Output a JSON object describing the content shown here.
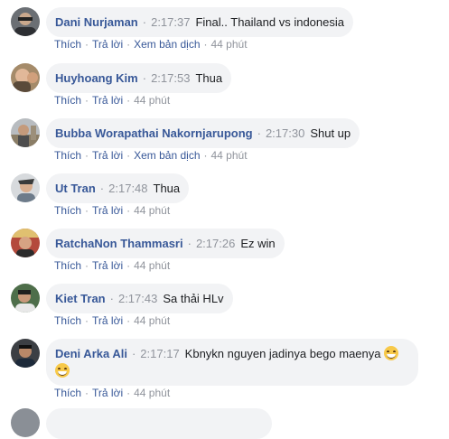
{
  "actions": {
    "like": "Thích",
    "reply": "Trả lời",
    "translate": "Xem bản dịch",
    "separator": "·"
  },
  "comments": [
    {
      "name": "Dani Nurjaman",
      "time": "2:17:37",
      "text": "Final.. Thailand vs indonesia",
      "age": "44 phút",
      "has_translate": true
    },
    {
      "name": "Huyhoang Kim",
      "time": "2:17:53",
      "text": "Thua",
      "age": "44 phút",
      "has_translate": false
    },
    {
      "name": "Bubba Worapathai Nakornjarupong",
      "time": "2:17:30",
      "text": "Shut up",
      "age": "44 phút",
      "has_translate": true
    },
    {
      "name": "Ut Tran",
      "time": "2:17:48",
      "text": "Thua",
      "age": "44 phút",
      "has_translate": false
    },
    {
      "name": "RatchaNon Thammasri",
      "time": "2:17:26",
      "text": "Ez win",
      "age": "44 phút",
      "has_translate": false
    },
    {
      "name": "Kiet Tran",
      "time": "2:17:43",
      "text": "Sa thải HLv",
      "age": "44 phút",
      "has_translate": false
    },
    {
      "name": "Deni Arka Ali",
      "time": "2:17:17",
      "text": "Kbnykn nguyen jadinya bego maenya",
      "age": "44 phút",
      "has_translate": false,
      "emoji": "grinning-face"
    }
  ]
}
